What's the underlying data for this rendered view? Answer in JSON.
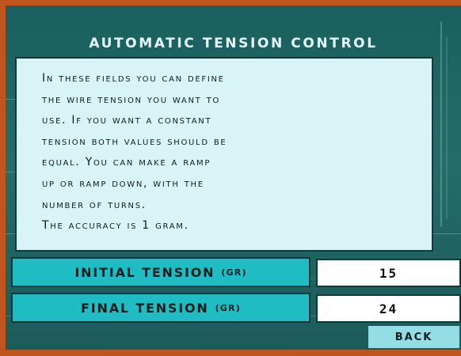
{
  "dialog": {
    "title": "AUTOMATIC TENSION CONTROL",
    "info_lines": [
      "In these fields you can define",
      "the wire tension you want to",
      "use. If you want a constant",
      "tension both values should be",
      "equal. You can make a ramp",
      "up or ramp down, with the",
      "number of turns.",
      "The accuracy is 1 gram."
    ]
  },
  "fields": {
    "initial": {
      "label": "INITIAL TENSION",
      "unit": "(GR)",
      "value": "15"
    },
    "final": {
      "label": "FINAL TENSION",
      "unit": "(GR)",
      "value": "24"
    }
  },
  "buttons": {
    "back_label": "BACK"
  },
  "colors": {
    "frame": "#c0561d",
    "panel": "#1a5f5f",
    "info_bg": "#d9f4f6",
    "label_bg": "#20bcc3",
    "button_bg": "#95dde5"
  }
}
